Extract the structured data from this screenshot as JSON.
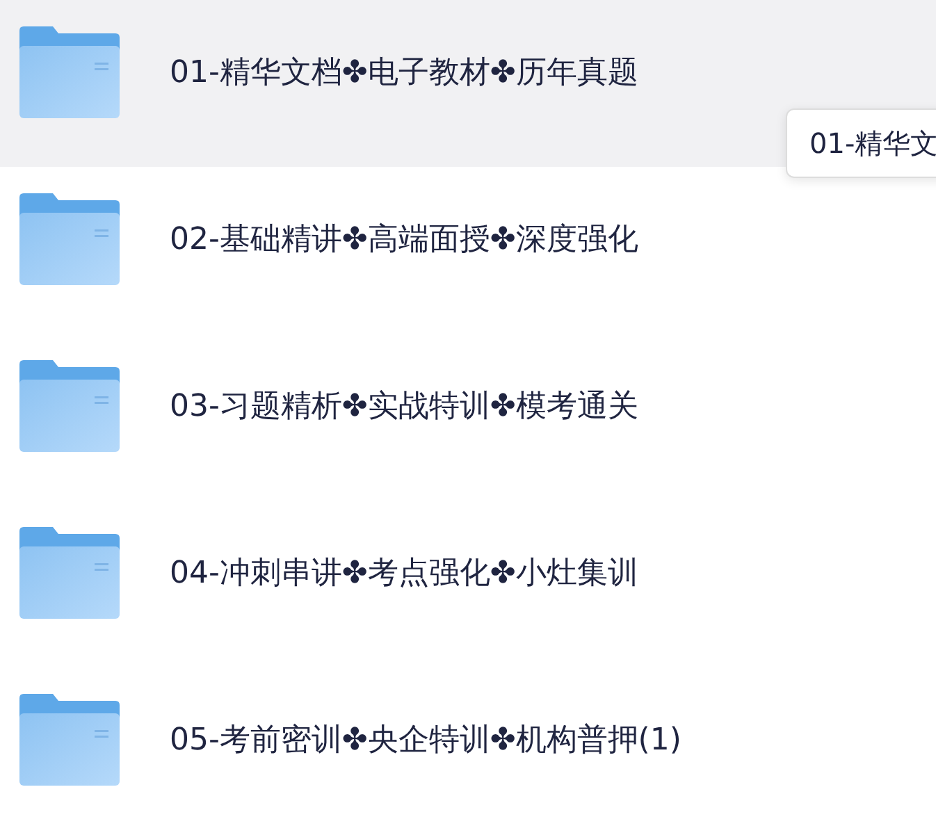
{
  "folders": [
    {
      "name": "01-精华文档✤电子教材✤历年真题",
      "selected": true
    },
    {
      "name": "02-基础精讲✤高端面授✤深度强化",
      "selected": false
    },
    {
      "name": "03-习题精析✤实战特训✤模考通关",
      "selected": false
    },
    {
      "name": "04-冲刺串讲✤考点强化✤小灶集训",
      "selected": false
    },
    {
      "name": "05-考前密训✤央企特训✤机构普押(1)",
      "selected": false
    }
  ],
  "tooltip": {
    "text": "01-精华文"
  }
}
